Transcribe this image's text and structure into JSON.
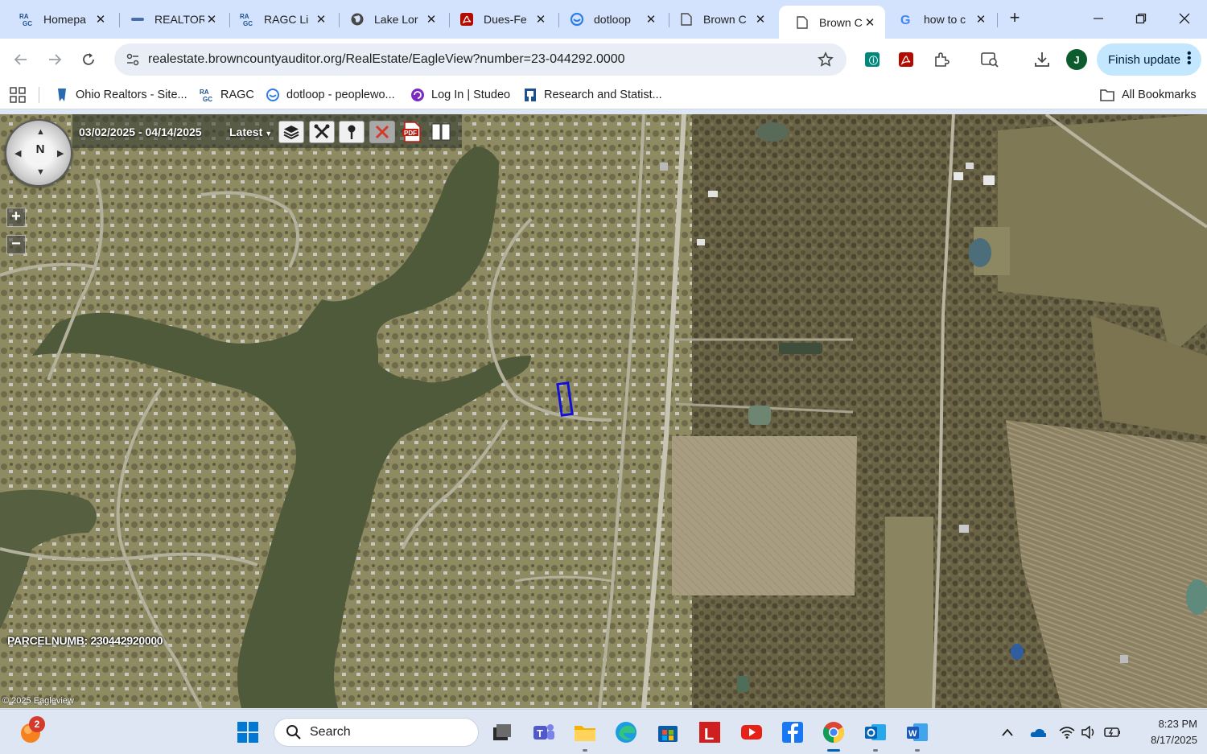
{
  "browser": {
    "tabs": [
      {
        "title": "Homepa",
        "favicon": "ragc-icon",
        "active": false
      },
      {
        "title": "REALTOR",
        "favicon": "realtor-icon",
        "active": false
      },
      {
        "title": "RAGC Li",
        "favicon": "ragc-icon",
        "active": false
      },
      {
        "title": "Lake Lor",
        "favicon": "globe-icon",
        "active": false
      },
      {
        "title": "Dues-Fe",
        "favicon": "pdf-icon",
        "active": false
      },
      {
        "title": "dotloop",
        "favicon": "dotloop-icon",
        "active": false
      },
      {
        "title": "Brown C",
        "favicon": "page-icon",
        "active": false
      },
      {
        "title": "Brown C",
        "favicon": "page-icon",
        "active": true
      },
      {
        "title": "how to c",
        "favicon": "google-icon",
        "active": false
      }
    ],
    "new_tab": "+",
    "address": "realestate.browncountyauditor.org/RealEstate/EagleView?number=23-044292.0000",
    "avatar_initial": "J",
    "finish_update_label": "Finish update"
  },
  "bookmarks": {
    "items": [
      {
        "label": "Ohio Realtors - Site..."
      },
      {
        "label": "RAGC"
      },
      {
        "label": "dotloop - peoplewo..."
      },
      {
        "label": "Log In | Studeo"
      },
      {
        "label": "Research and Statist..."
      }
    ],
    "all_bookmarks": "All Bookmarks"
  },
  "map": {
    "compass_label": "N",
    "zoom_in": "+",
    "zoom_out": "−",
    "date_range": "03/02/2025 - 04/14/2025",
    "imagery_select": "Latest",
    "parcel_label": "PARCELNUMB: 230442920000",
    "copyright": "© 2025 Eagleview",
    "tools": [
      "layers-icon",
      "tools-icon",
      "pin-icon",
      "clear-icon",
      "pdf-export-icon",
      "split-view-icon"
    ]
  },
  "taskbar": {
    "search_label": "Search",
    "notification_count": "2",
    "time": "8:23 PM",
    "date": "8/17/2025"
  },
  "colors": {
    "tabstrip": "#d3e3fd",
    "parcel_outline": "#1010d8",
    "finish_update_bg": "#c2e7ff"
  }
}
